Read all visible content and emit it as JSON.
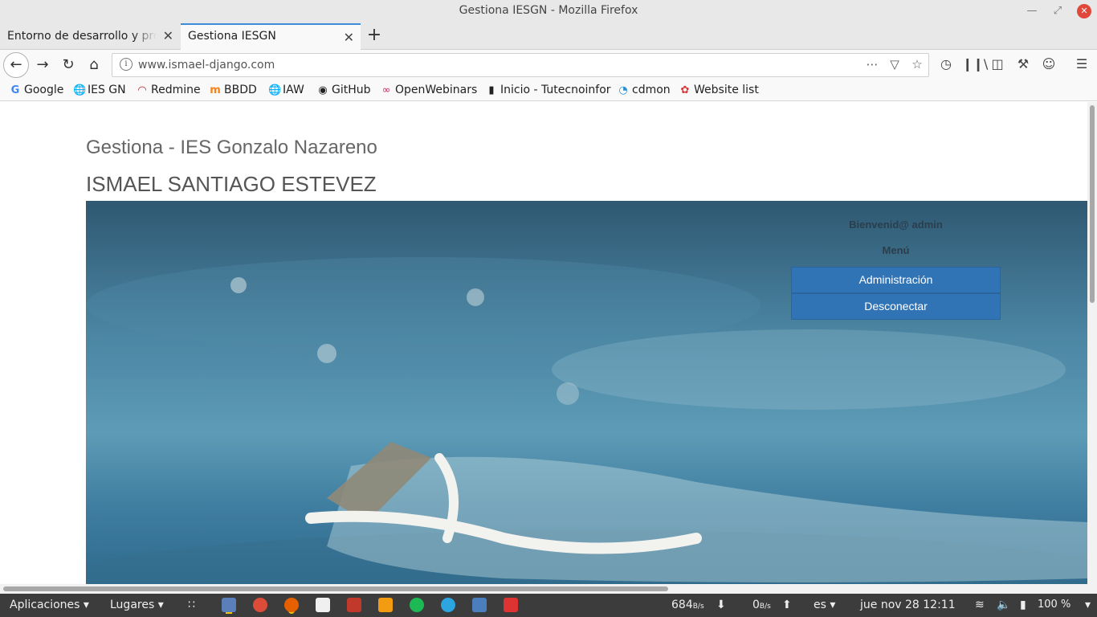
{
  "window": {
    "title": "Gestiona IESGN - Mozilla Firefox"
  },
  "tabs": [
    {
      "label": "Entorno de desarrollo y producción",
      "active": false
    },
    {
      "label": "Gestiona IESGN",
      "active": true
    }
  ],
  "navbar": {
    "url": "www.ismael-django.com"
  },
  "bookmarks": [
    {
      "label": "Google",
      "icon": "google-icon"
    },
    {
      "label": "IES GN",
      "icon": "globe-icon"
    },
    {
      "label": "Redmine",
      "icon": "redmine-icon"
    },
    {
      "label": "BBDD",
      "icon": "moodle-icon"
    },
    {
      "label": "IAW",
      "icon": "globe-icon"
    },
    {
      "label": "GitHub",
      "icon": "github-icon"
    },
    {
      "label": "OpenWebinars",
      "icon": "openwebinars-icon"
    },
    {
      "label": "Inicio - Tutecnoinfor",
      "icon": "book-icon"
    },
    {
      "label": "cdmon",
      "icon": "cdmon-icon"
    },
    {
      "label": "Website list",
      "icon": "website-list-icon"
    }
  ],
  "page": {
    "site_title": "Gestiona - IES Gonzalo Nazareno",
    "user_name": "ISMAEL SANTIAGO ESTEVEZ",
    "welcome": "Bienvenid@ admin",
    "menu_title": "Menú",
    "menu_items": [
      "Administración",
      "Desconectar"
    ]
  },
  "taskbar": {
    "applications": "Aplicaciones",
    "places": "Lugares",
    "net_down_value": "684",
    "net_down_unit": "B/s",
    "net_up_value": "0",
    "net_up_unit": "B/s",
    "keyboard_layout": "es",
    "datetime": "jue nov 28  12:11",
    "battery": "100 %"
  },
  "colors": {
    "menu_button": "#3174b6",
    "active_tab_accent": "#3c8cd8",
    "taskbar_bg": "#3c3c3c",
    "close_button": "#e0483b"
  }
}
